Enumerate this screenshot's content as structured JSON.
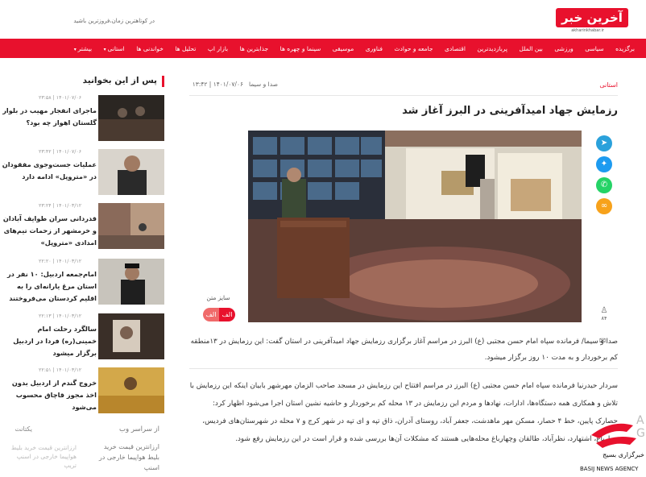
{
  "site": {
    "logo_text": "آخرین خبر",
    "logo_sub": "akharinkhabar.ir",
    "tagline": "در کوتاهترین زمان،فروزترین باشید"
  },
  "nav": [
    {
      "label": "برگزیده"
    },
    {
      "label": "سیاسی"
    },
    {
      "label": "ورزشی"
    },
    {
      "label": "بین الملل"
    },
    {
      "label": "پربازدیدترین"
    },
    {
      "label": "اقتصادی"
    },
    {
      "label": "جامعه و حوادث"
    },
    {
      "label": "فناوری"
    },
    {
      "label": "موسیقی"
    },
    {
      "label": "سینما و چهره ها"
    },
    {
      "label": "جذابترین ها"
    },
    {
      "label": "بازار اپ"
    },
    {
      "label": "تحلیل ها"
    },
    {
      "label": "خواندنی ها"
    },
    {
      "label": "استانی"
    },
    {
      "label": "بیشتر"
    }
  ],
  "article": {
    "category": "استانی",
    "agency": "صدا و سیما",
    "date": "۱۴۰۱/۰۷/۰۶ | ۱۳:۴۲",
    "title": "رزمایش جهاد امیدآفرینی در البرز آغاز شد",
    "font_size_label": "سایز متن",
    "font_minus": "الف",
    "font_plus": "الف",
    "views": "۸۴",
    "lead": "صدا و سیما/ فرمانده سپاه امام حسن مجتبی (ع) البرز در مراسم آغاز برگزاری رزمایش جهاد امیدآفرینی در استان گفت: این رزمایش در ۱۳منطقه کم برخوردار و به مدت ۱۰ روز برگزار میشود.",
    "body": "سردار حیدرنیا فرمانده سپاه امام حسن مجتبی (ع) البرز در مراسم افتتاح این رزمایش در مسجد صاحب الزمان مهرشهر بابیان اینکه این رزمایش با تلاش و همکاری همه دستگاه‌ها، ادارات، نهادها و مردم این رزمایش در ۱۳ محله کم برخوردار و حاشیه نشین استان اجرا می‌شود اظهار کرد: حصارک پایین، خط ۴ حصار، مسکن مهر ماهدشت، جعفر آباد، روستای آدران، ذاق تپه و ای تپه در شهر کرج و ۷ محله در شهرستان‌های فردیس، چهارباغ، اشتهارد، نظرآباد، طالقان وچهارباغ محله‌هایی هستند که مشکلات آن‌ها بررسی شده و قرار است در این رزمایش رفع شود."
  },
  "sidebar": {
    "heading": "پس از این بخوانید",
    "items": [
      {
        "date": "۱۴۰۱/۰۷/۰۶ | ۲۳:۵۸",
        "text": "ماجرای انفجار مهیب در بلوار گلستان اهواز چه بود؟"
      },
      {
        "date": "۱۴۰۱/۰۷/۰۶ | ۲۳:۴۲",
        "text": "عملیات جست‌وجوی مفقودان در «متروپل» ادامه دارد"
      },
      {
        "date": "۱۴۰۱/۰۳/۱۲ | ۲۳:۲۴",
        "text": "قدردانی سران طوایف آبادان و خرمشهر از زحمات تیم‌های امدادی «متروپل»"
      },
      {
        "date": "۱۴۰۱/۰۳/۱۲ | ۲۲:۲۰",
        "text": "امام‌جمعه اردبیل: ۱۰ نفر در استان مرغ یارانه‌ای را به اقلیم کردستان می‌فروختند"
      },
      {
        "date": "۱۴۰۱/۰۳/۱۲ | ۲۲:۱۳",
        "text": "سالگرد رحلت امام خمینی(ره) فردا در اردبیل برگزار میشود"
      },
      {
        "date": "۱۴۰۱/۰۳/۱۲ | ۲۲:۵۱",
        "text": "خروج گندم از اردبیل بدون اخذ مجوز قاچاق محسوب می‌شود"
      }
    ],
    "from_heading": "از سراسر وب",
    "from_item": "ارزانترین قیمت خرید بلیط هواپیما خارجی در اسنپ",
    "ad_heading": "یکتانت",
    "ad_item": "ارزانترین قیمت خرید بلیط هواپیما خارجی در اسنپ تریپ"
  },
  "watermark": {
    "fa": "خبرگزاری بسیج",
    "en": "BASIJ NEWS AGENCY",
    "side": "A G"
  },
  "colors": {
    "accent": "#e8112d"
  }
}
